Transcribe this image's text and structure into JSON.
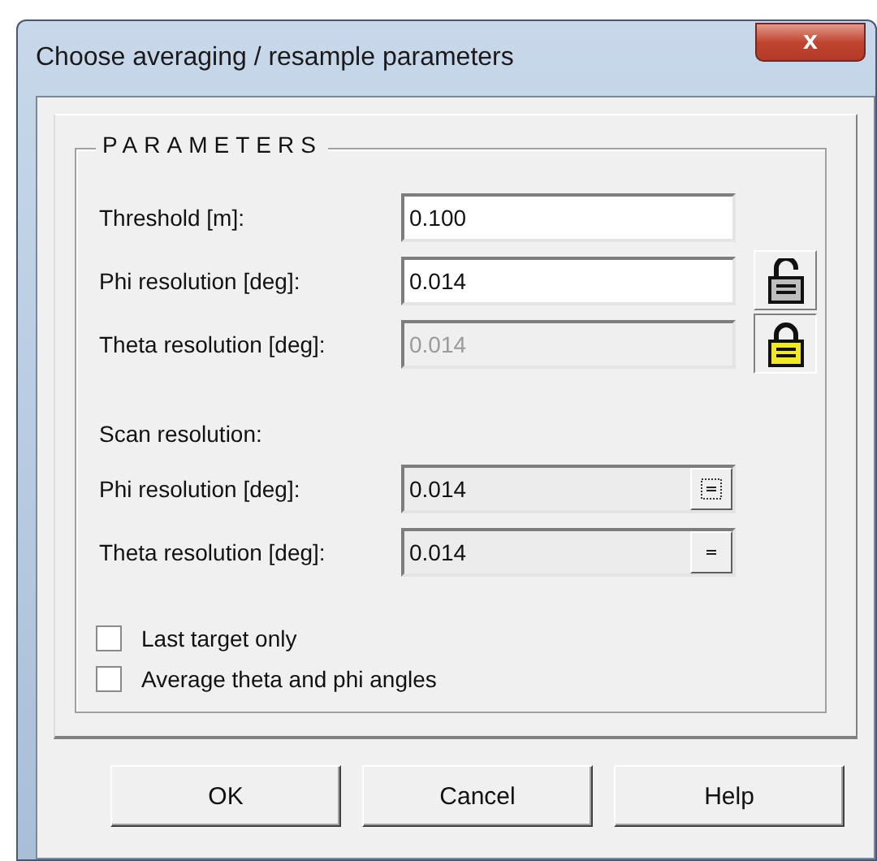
{
  "window": {
    "title": "Choose averaging / resample parameters",
    "close_label": "x"
  },
  "group": {
    "title": "PARAMETERS",
    "fields": [
      {
        "kind": "text",
        "label": "Threshold [m]:",
        "value": "0.100",
        "disabled": false
      },
      {
        "kind": "locked",
        "label": "Phi resolution [deg]:",
        "value": "0.014",
        "disabled": false,
        "locked": false
      },
      {
        "kind": "locked",
        "label": "Theta resolution [deg]:",
        "value": "0.014",
        "disabled": true,
        "locked": true
      }
    ],
    "scan_heading": "Scan resolution:",
    "scan_fields": [
      {
        "label": "Phi resolution [deg]:",
        "value": "0.014",
        "focused": true
      },
      {
        "label": "Theta resolution [deg]:",
        "value": "0.014",
        "focused": false
      }
    ],
    "checkboxes": [
      {
        "label": "Last target only",
        "checked": false
      },
      {
        "label": "Average theta and phi angles",
        "checked": false
      }
    ]
  },
  "buttons": [
    "OK",
    "Cancel",
    "Help"
  ]
}
